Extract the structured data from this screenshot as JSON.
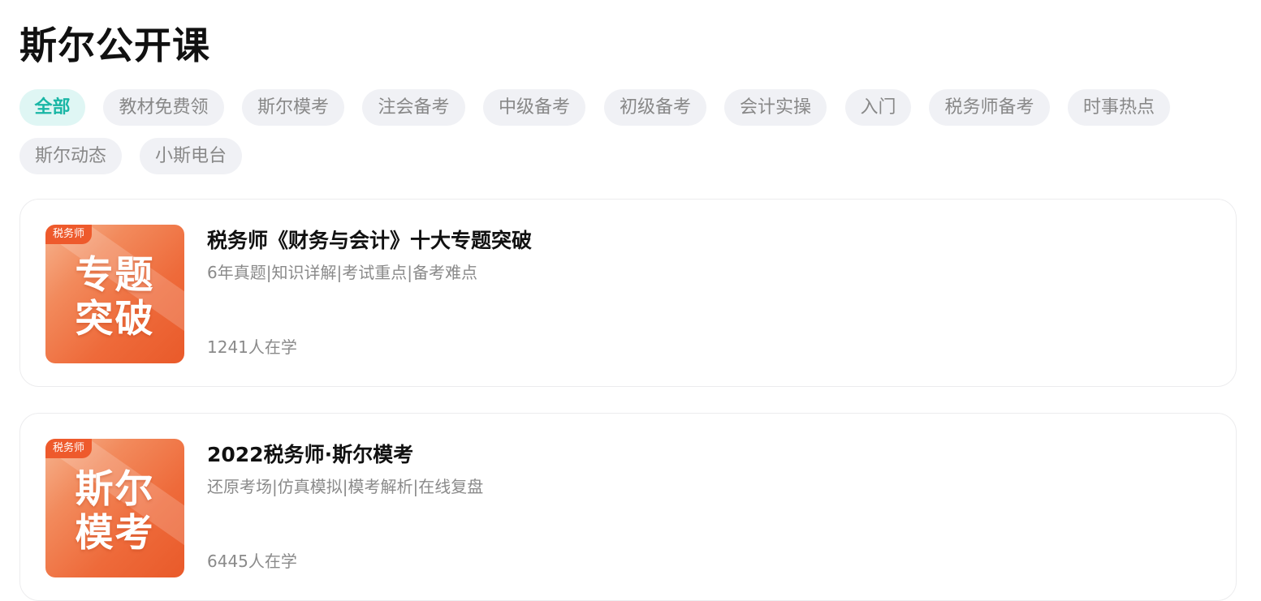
{
  "page_title": "斯尔公开课",
  "tags": [
    {
      "label": "全部",
      "active": true
    },
    {
      "label": "教材免费领"
    },
    {
      "label": "斯尔模考"
    },
    {
      "label": "注会备考"
    },
    {
      "label": "中级备考"
    },
    {
      "label": "初级备考"
    },
    {
      "label": "会计实操"
    },
    {
      "label": "入门"
    },
    {
      "label": "税务师备考"
    },
    {
      "label": "时事热点"
    },
    {
      "label": "斯尔动态"
    },
    {
      "label": "小斯电台"
    }
  ],
  "courses": [
    {
      "thumb_tag": "税务师",
      "thumb_line1": "专题",
      "thumb_line2": "突破",
      "title": "税务师《财务与会计》十大专题突破",
      "subtitle": "6年真题|知识详解|考试重点|备考难点",
      "learners": "1241人在学"
    },
    {
      "thumb_tag": "税务师",
      "thumb_line1": "斯尔",
      "thumb_line2": "模考",
      "title": "2022税务师·斯尔模考",
      "subtitle": "还原考场|仿真模拟|模考解析|在线复盘",
      "learners": "6445人在学"
    }
  ],
  "colors": {
    "accent_teal": "#19b6a5",
    "accent_teal_bg": "#dff6f4",
    "thumb_orange": "#ee6a3a"
  }
}
